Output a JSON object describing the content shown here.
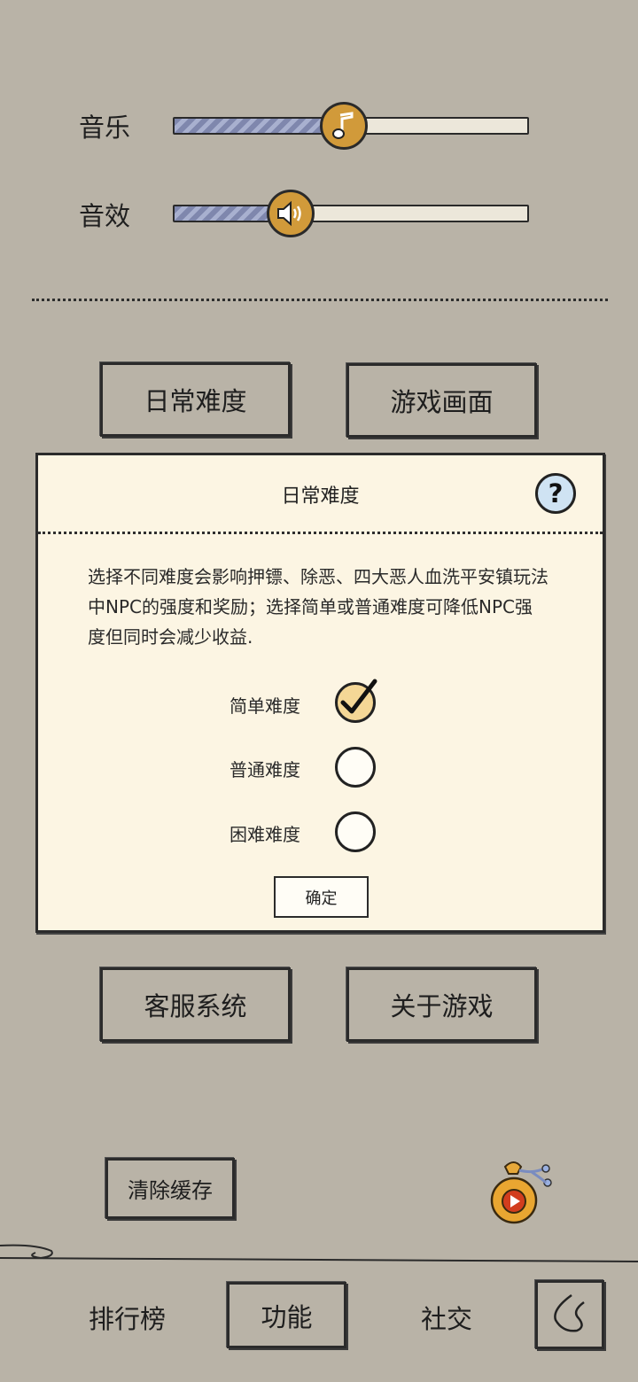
{
  "audio": {
    "music": {
      "label": "音乐",
      "level": 0.48
    },
    "sfx": {
      "label": "音效",
      "level": 0.33
    }
  },
  "menu": {
    "daily_difficulty": "日常难度",
    "game_display": "游戏画面",
    "customer_service": "客服系统",
    "about_game": "关于游戏",
    "clear_cache": "清除缓存"
  },
  "dialog": {
    "title": "日常难度",
    "help_symbol": "?",
    "description": "选择不同难度会影响押镖、除恶、四大恶人血洗平安镇玩法中NPC的强度和奖励；选择简单或普通难度可降低NPC强度但同时会减少收益.",
    "options": [
      {
        "label": "简单难度",
        "checked": true
      },
      {
        "label": "普通难度",
        "checked": false
      },
      {
        "label": "困难难度",
        "checked": false
      }
    ],
    "confirm": "确定"
  },
  "bottom_nav": {
    "ranking": "排行榜",
    "functions": "功能",
    "social": "社交"
  },
  "colors": {
    "background": "#b9b3a7",
    "dialog_bg": "#fcf5e3",
    "knob": "#d19a3a",
    "slider_fill": "#8d94b8",
    "help_bg": "#cfe3f3",
    "checked_radio": "#f4d796"
  },
  "icons": {
    "music_knob": "music-note-icon",
    "sfx_knob": "speaker-icon",
    "gift": "money-bag-play-icon",
    "back": "curved-back-icon"
  }
}
